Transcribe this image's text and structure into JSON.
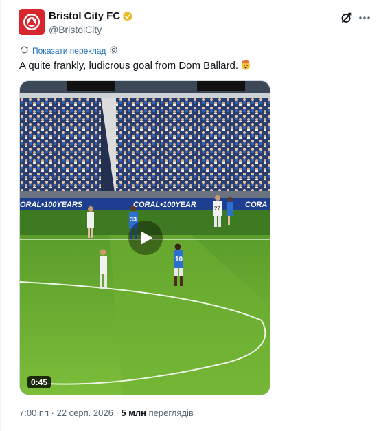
{
  "author": {
    "display_name": "Bristol City FC",
    "handle": "@BristolCity",
    "verified_color": "#e8b923",
    "avatar_color": "#d8262f"
  },
  "actions": {
    "grok_icon": "grok-icon",
    "more_icon": "more-icon"
  },
  "translate": {
    "label": "Показати переклад",
    "icon": "translate-icon",
    "settings_icon": "gear-icon"
  },
  "tweet": {
    "text": "A quite frankly, ludicrous goal from Dom Ballard.",
    "emoji": "exploding-head-emoji"
  },
  "video": {
    "duration": "0:45",
    "play_icon": "play-icon",
    "board_text": "CORAL 100 YEARS",
    "players": [
      "33",
      "10",
      "27"
    ]
  },
  "meta": {
    "time": "7:00 пп",
    "separator": "·",
    "date": "22 серп. 2026",
    "views_count": "5 млн",
    "views_label": "переглядів"
  }
}
